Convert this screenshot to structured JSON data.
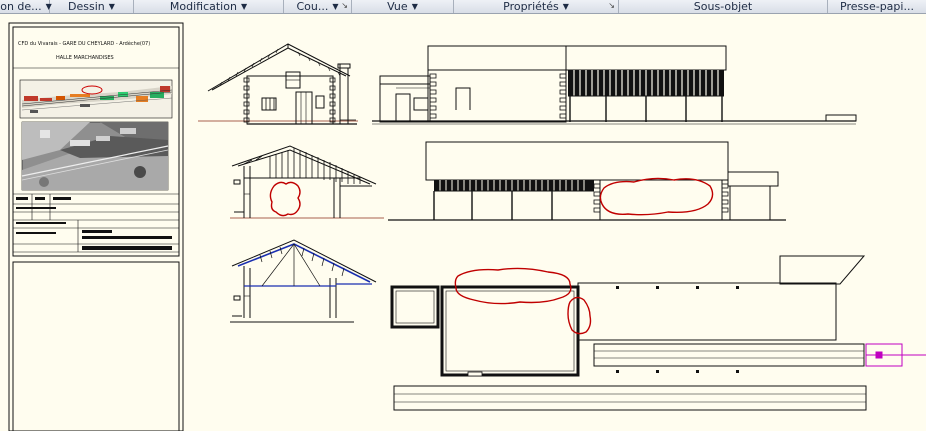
{
  "ribbon": {
    "panels": [
      {
        "label": "ion de...",
        "arrow": "▼"
      },
      {
        "label": "Dessin",
        "arrow": "▼"
      },
      {
        "label": "Modification",
        "arrow": "▼"
      },
      {
        "label": "Cou...",
        "arrow": "▼"
      },
      {
        "label": "Vue",
        "arrow": "▼"
      },
      {
        "label": "Propriétés",
        "arrow": "▼"
      },
      {
        "label": "Sous-objet",
        "arrow": ""
      },
      {
        "label": "Presse-papi...",
        "arrow": ""
      }
    ],
    "launcher_glyph": "↘"
  },
  "title_block": {
    "project_line": "CFD du Vivarais - GARE DU CHEYLARD - Ardèche(07)",
    "subtitle": "HALLE MARCHANDISES"
  },
  "colors": {
    "background": "#fffdef",
    "line": "#111111",
    "markup_red": "#c00000",
    "construction_blue": "#1a2fb0",
    "grip_magenta": "#c000c0",
    "red_baseline": "#8b2d1a"
  },
  "markups": {
    "revision_clouds": 4
  }
}
